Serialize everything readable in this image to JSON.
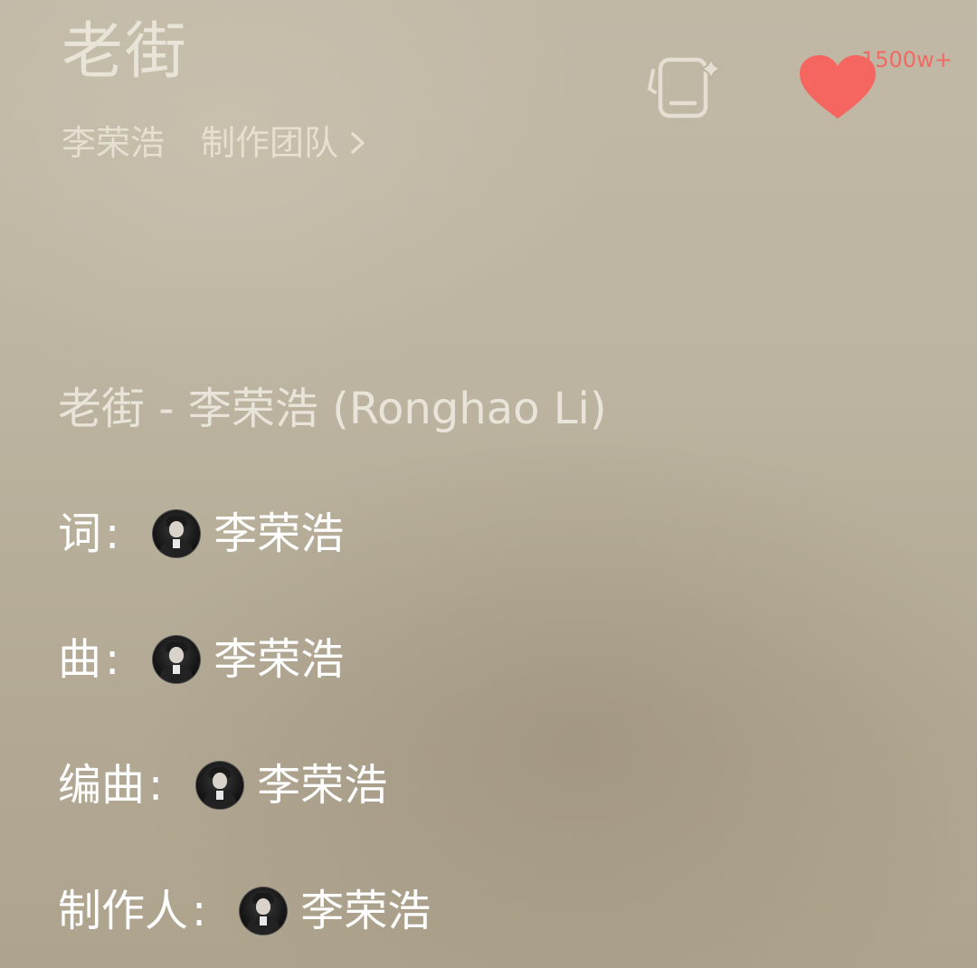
{
  "song": {
    "title": "老街",
    "artist": "李荣浩",
    "team_link_label": "制作团队"
  },
  "actions": {
    "like_count": "1500w+",
    "like_color": "#f4665f"
  },
  "credits": {
    "header": "老街 - 李荣浩 (Ronghao Li)",
    "rows": [
      {
        "label": "词",
        "colon": ":",
        "name": "李荣浩"
      },
      {
        "label": "曲",
        "colon": ":",
        "name": "李荣浩"
      },
      {
        "label": "编曲",
        "colon": ":",
        "name": "李荣浩"
      },
      {
        "label": "制作人",
        "colon": ":",
        "name": "李荣浩"
      }
    ]
  },
  "icons": {
    "chevron": "chevron-right-icon",
    "ai_card": "ai-card-sparkle-icon",
    "like": "heart-icon",
    "avatar": "artist-avatar"
  }
}
